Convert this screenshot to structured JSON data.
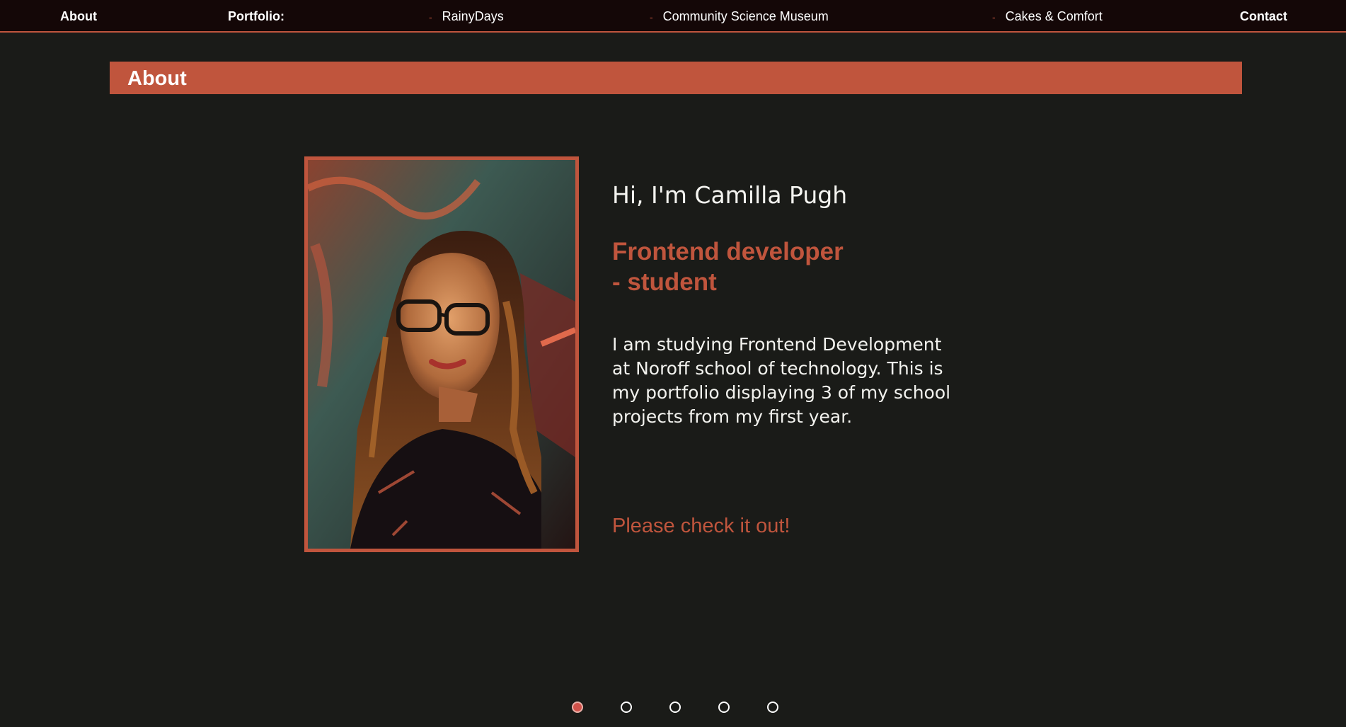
{
  "nav": {
    "about": "About",
    "portfolio": "Portfolio:",
    "dash": "-",
    "project1": "RainyDays",
    "project2": "Community Science Museum",
    "project3": "Cakes & Comfort",
    "contact": "Contact"
  },
  "section": {
    "title": "About"
  },
  "intro": {
    "greeting": "Hi, I'm Camilla Pugh",
    "role_line1": "Frontend developer",
    "role_line2": "- student",
    "bio": "I am studying Frontend Development at Noroff school of technology. This is my portfolio displaying 3 of my school projects from my first year.",
    "cta": "Please check it out!"
  },
  "portrait": {
    "icon": "portrait-photo"
  },
  "pagination": {
    "count": 5,
    "active_index": 0
  },
  "colors": {
    "accent": "#c0553d",
    "background": "#1a1b18",
    "nav_background": "#140707",
    "active_dot": "#d0524a"
  }
}
